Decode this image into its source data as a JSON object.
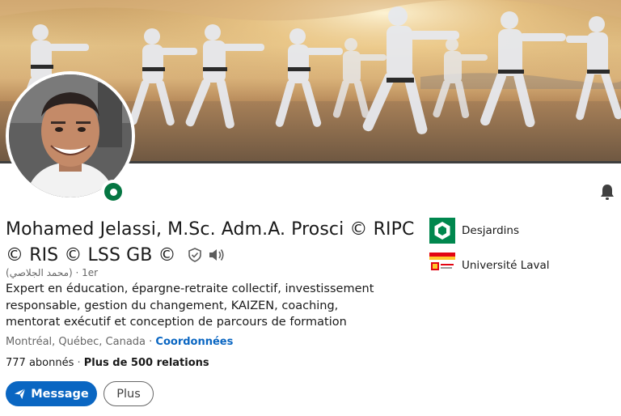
{
  "profile": {
    "name": "Mohamed Jelassi, M.Sc. Adm.A. Prosci © RIPC © RIS © LSS GB ©",
    "alt_name": "(محمد الجلاصي)",
    "degree": "· 1er",
    "headline": "Expert en éducation, épargne-retraite collectif, investissement responsable, gestion du changement, KAIZEN, coaching, mentorat exécutif et conception de parcours de formation",
    "location": "Montréal, Québec, Canada",
    "location_sep": " · ",
    "contact_link": "Coordonnées",
    "followers": "777 abonnés",
    "connections_sep": " · ",
    "connections": "Plus de 500 relations"
  },
  "actions": {
    "message_label": "Message",
    "more_label": "Plus"
  },
  "experience_orgs": [
    {
      "name": "Desjardins",
      "icon": "desjardins-logo"
    },
    {
      "name": "Université Laval",
      "icon": "laval-logo"
    }
  ],
  "icons": {
    "verified": "shield-check-icon",
    "pronunciation": "speaker-icon",
    "notification": "bell-icon",
    "status": "open-to-work-dot"
  },
  "colors": {
    "primary": "#0a66c2",
    "status_green": "#057642",
    "desjardins_green": "#00874e",
    "laval_red": "#e30513",
    "laval_gold": "#ffc72c"
  }
}
